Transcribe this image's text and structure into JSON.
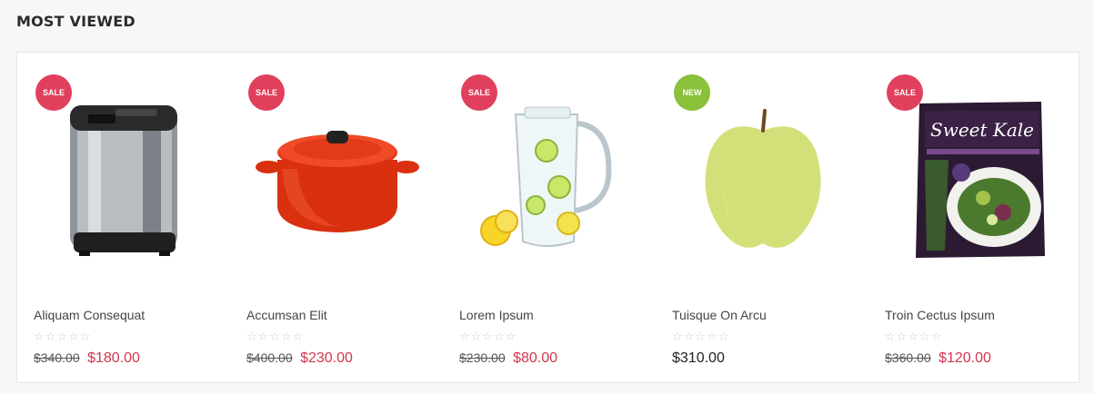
{
  "section": {
    "title": "MOST VIEWED"
  },
  "products": [
    {
      "badge": "SALE",
      "name": "Aliquam Consequat",
      "rating": "☆☆☆☆☆",
      "old_price": "$340.00",
      "price": "$180.00",
      "image": "bread-maker"
    },
    {
      "badge": "SALE",
      "name": "Accumsan Elit",
      "rating": "☆☆☆☆☆",
      "old_price": "$400.00",
      "price": "$230.00",
      "image": "red-casserole-pot"
    },
    {
      "badge": "SALE",
      "name": "Lorem Ipsum",
      "rating": "☆☆☆☆☆",
      "old_price": "$230.00",
      "price": "$80.00",
      "image": "water-pitcher-with-lemons"
    },
    {
      "badge": "NEW",
      "name": "Tuisque On Arcu",
      "rating": "☆☆☆☆☆",
      "old_price": "",
      "price": "$310.00",
      "image": "green-apple"
    },
    {
      "badge": "SALE",
      "name": "Troin Cectus Ipsum",
      "rating": "☆☆☆☆☆",
      "old_price": "$360.00",
      "price": "$120.00",
      "image": "sweet-kale-salad-bag",
      "package_text": "Sweet Kale"
    }
  ],
  "colors": {
    "sale_badge": "#e0405c",
    "new_badge": "#8ac03a",
    "price": "#d2364f"
  }
}
